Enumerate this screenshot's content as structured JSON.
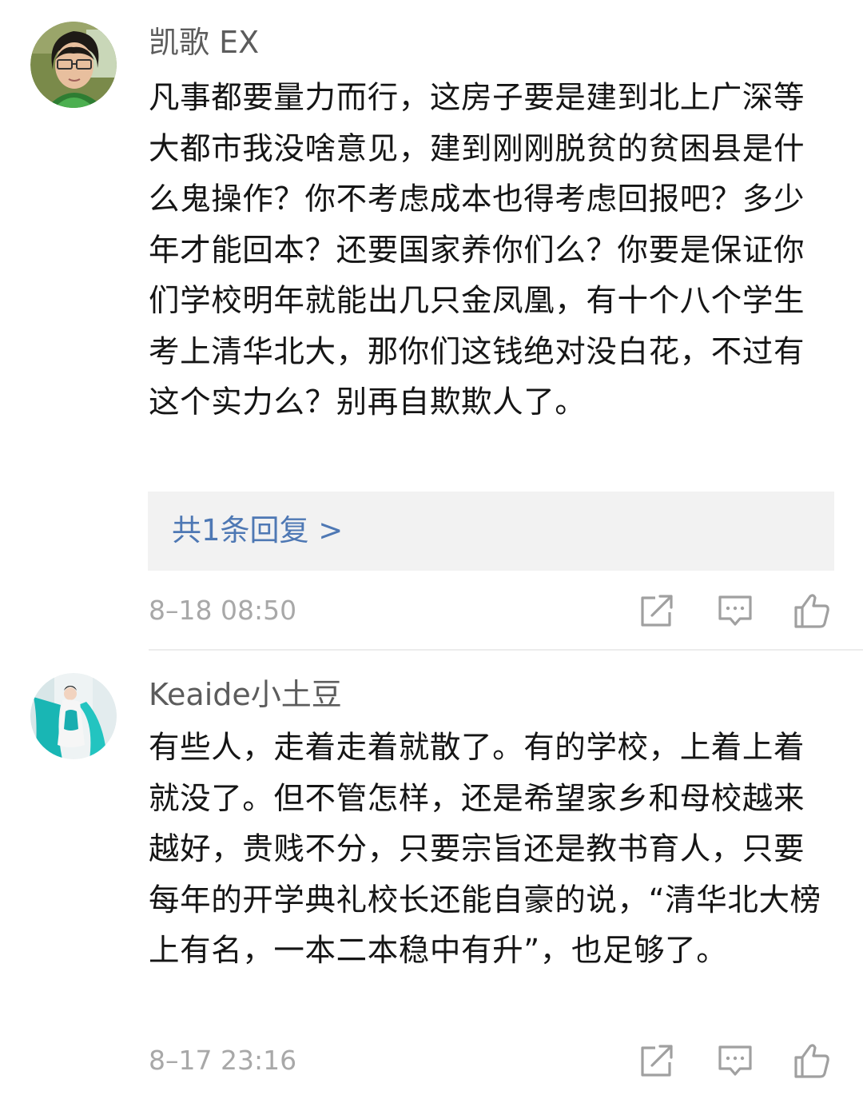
{
  "comments": [
    {
      "username": "凯歌 EX",
      "text": "凡事都要量力而行，这房子要是建到北上广深等大都市我没啥意见，建到刚刚脱贫的贫困县是什么鬼操作？你不考虑成本也得考虑回报吧？多少年才能回本？还要国家养你们么？你要是保证你们学校明年就能出几只金凤凰，有十个八个学生考上清华北大，那你们这钱绝对没白花，不过有这个实力么？别再自欺欺人了。",
      "replies_label": "共1条回复 >",
      "timestamp": "8–18 08:50",
      "avatar_icon": "avatar-glasses-man",
      "actions": [
        "share-icon",
        "reply-icon",
        "like-icon"
      ]
    },
    {
      "username": "Keaide小土豆",
      "text": "有些人，走着走着就散了。有的学校，上着上着就没了。但不管怎样，还是希望家乡和母校越来越好，贵贱不分，只要宗旨还是教书育人，只要每年的开学典礼校长还能自豪的说，“清华北大榜上有名，一本二本稳中有升”，也足够了。",
      "timestamp": "8–17 23:16",
      "avatar_icon": "avatar-woman-teal-dress",
      "actions": [
        "share-icon",
        "reply-icon",
        "like-icon"
      ]
    }
  ],
  "colors": {
    "username": "#5c5c5c",
    "body_text": "#151515",
    "link": "#4e78b4",
    "meta": "#a8a8a8",
    "reply_box_bg": "#f2f2f2",
    "icon": "#a0a0a0"
  }
}
